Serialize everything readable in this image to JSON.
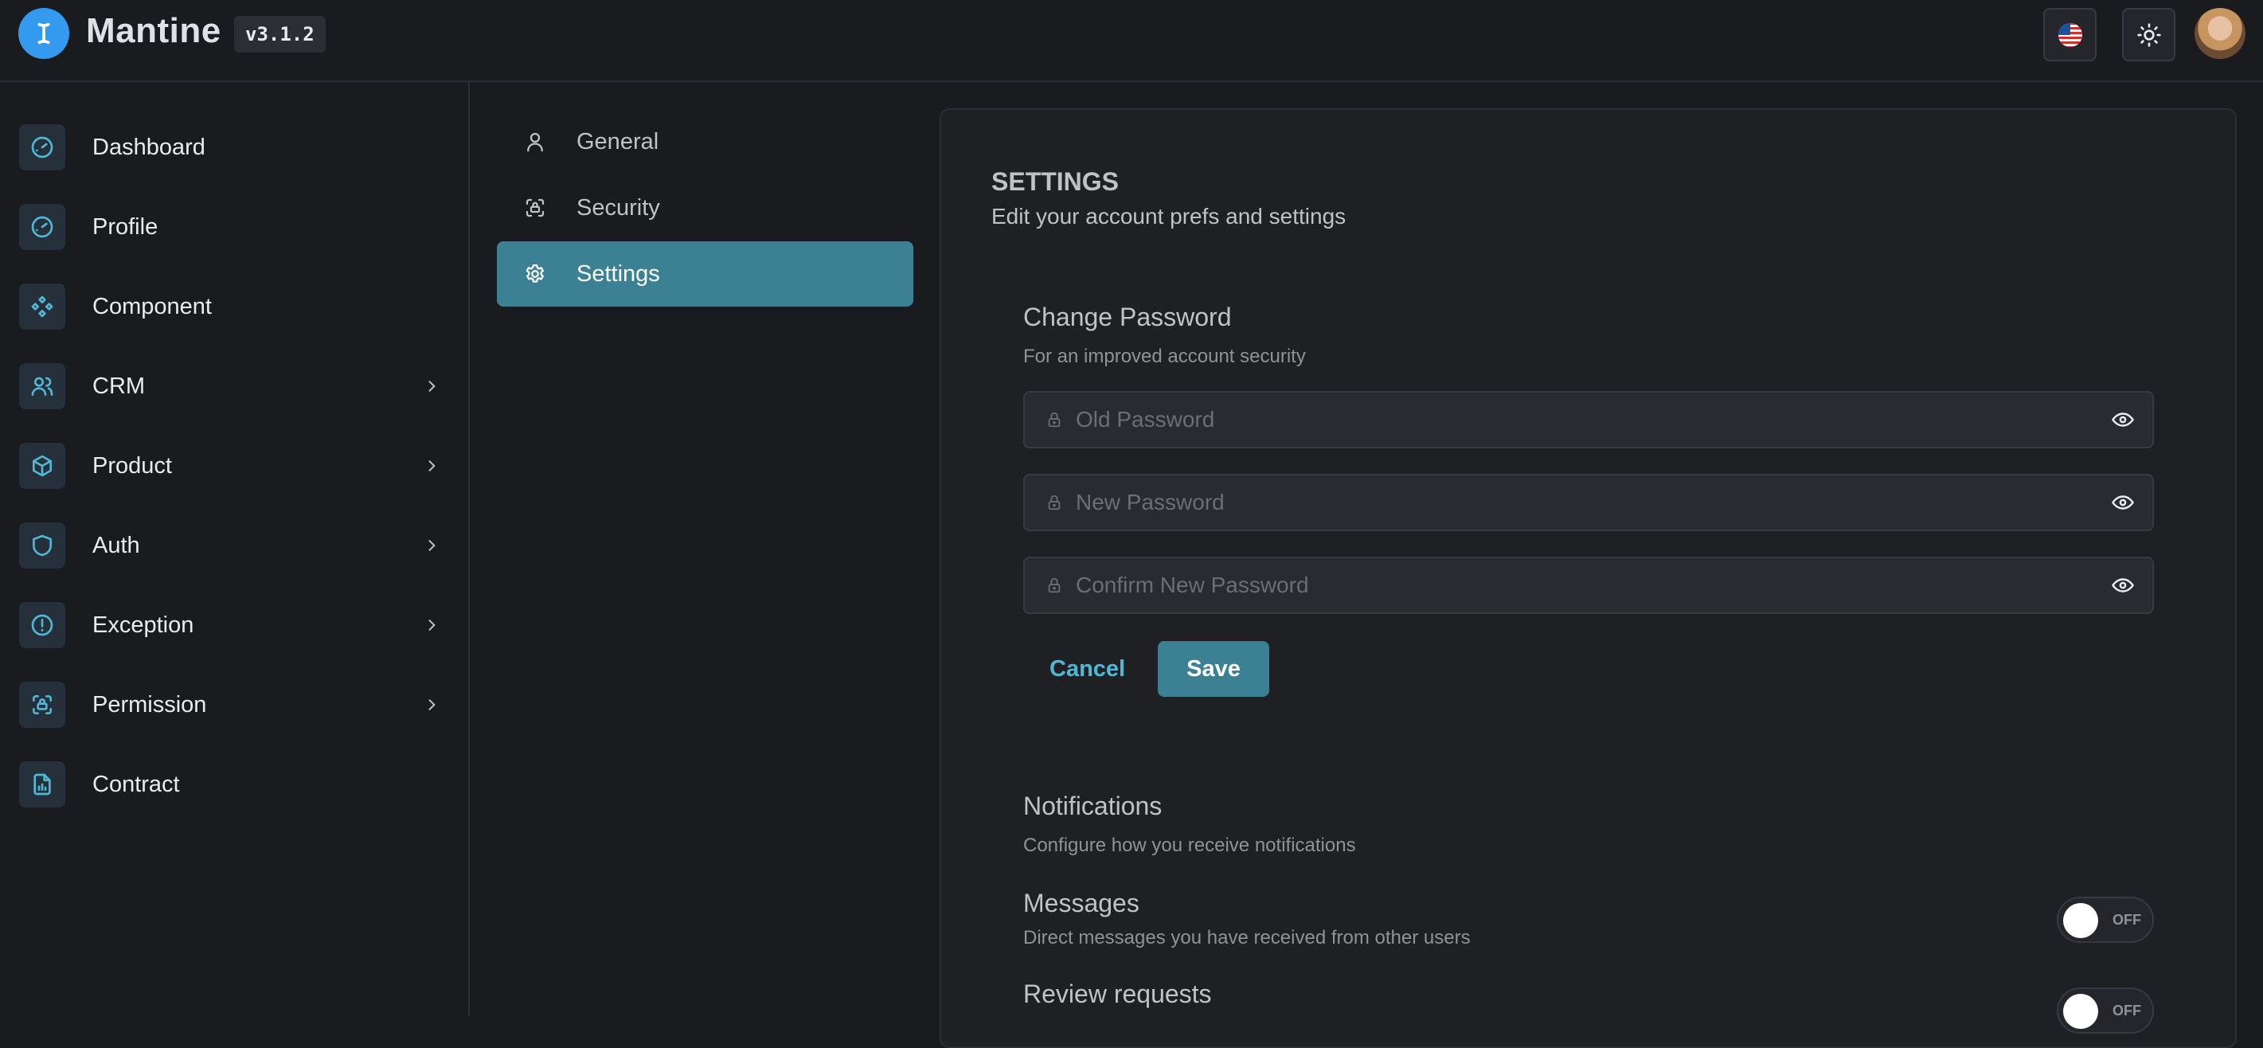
{
  "header": {
    "brand": "Mantine",
    "version": "v3.1.2"
  },
  "sidebar": {
    "items": [
      {
        "label": "Dashboard"
      },
      {
        "label": "Profile"
      },
      {
        "label": "Component"
      },
      {
        "label": "CRM"
      },
      {
        "label": "Product"
      },
      {
        "label": "Auth"
      },
      {
        "label": "Exception"
      },
      {
        "label": "Permission"
      },
      {
        "label": "Contract"
      }
    ]
  },
  "subnav": {
    "items": [
      {
        "label": "General"
      },
      {
        "label": "Security"
      },
      {
        "label": "Settings"
      }
    ],
    "active": "Settings"
  },
  "settings": {
    "title": "SETTINGS",
    "subtitle": "Edit your account prefs and settings",
    "change_password": {
      "title": "Change Password",
      "subtitle": "For an improved account security",
      "old_placeholder": "Old Password",
      "new_placeholder": "New Password",
      "confirm_placeholder": "Confirm New Password",
      "cancel_label": "Cancel",
      "save_label": "Save"
    },
    "notifications": {
      "title": "Notifications",
      "subtitle": "Configure how you receive notifications",
      "items": [
        {
          "label": "Messages",
          "description": "Direct messages you have received from other users",
          "state": "OFF"
        },
        {
          "label": "Review requests",
          "state": "OFF"
        }
      ]
    }
  },
  "colors": {
    "accent": "#3b8193",
    "link": "#4fb8d6",
    "logo": "#339af0",
    "background": "#1a1b1e"
  }
}
